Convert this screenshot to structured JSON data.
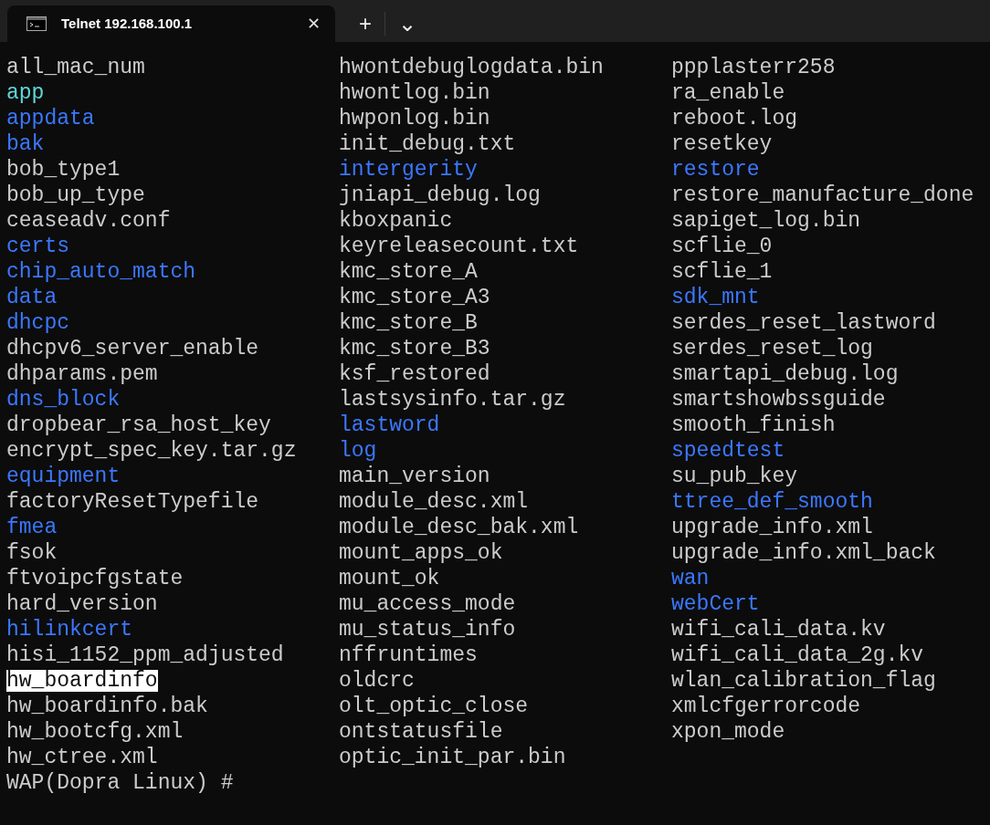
{
  "tab": {
    "title": "Telnet 192.168.100.1",
    "selected": true,
    "close": "✕"
  },
  "tab_actions": {
    "new_tab": "+",
    "dropdown": "⌄"
  },
  "entries": [
    {
      "name": "all_mac_num",
      "kind": "file",
      "selected": false
    },
    {
      "name": "app",
      "kind": "link",
      "selected": false
    },
    {
      "name": "appdata",
      "kind": "dir",
      "selected": false
    },
    {
      "name": "bak",
      "kind": "dir",
      "selected": false
    },
    {
      "name": "bob_type1",
      "kind": "file",
      "selected": false
    },
    {
      "name": "bob_up_type",
      "kind": "file",
      "selected": false
    },
    {
      "name": "ceaseadv.conf",
      "kind": "file",
      "selected": false
    },
    {
      "name": "certs",
      "kind": "dir",
      "selected": false
    },
    {
      "name": "chip_auto_match",
      "kind": "dir",
      "selected": false
    },
    {
      "name": "data",
      "kind": "dir",
      "selected": false
    },
    {
      "name": "dhcpc",
      "kind": "dir",
      "selected": false
    },
    {
      "name": "dhcpv6_server_enable",
      "kind": "file",
      "selected": false
    },
    {
      "name": "dhparams.pem",
      "kind": "file",
      "selected": false
    },
    {
      "name": "dns_block",
      "kind": "dir",
      "selected": false
    },
    {
      "name": "dropbear_rsa_host_key",
      "kind": "file",
      "selected": false
    },
    {
      "name": "encrypt_spec_key.tar.gz",
      "kind": "file",
      "selected": false
    },
    {
      "name": "equipment",
      "kind": "dir",
      "selected": false
    },
    {
      "name": "factoryResetTypefile",
      "kind": "file",
      "selected": false
    },
    {
      "name": "fmea",
      "kind": "dir",
      "selected": false
    },
    {
      "name": "fsok",
      "kind": "file",
      "selected": false
    },
    {
      "name": "ftvoipcfgstate",
      "kind": "file",
      "selected": false
    },
    {
      "name": "hard_version",
      "kind": "file",
      "selected": false
    },
    {
      "name": "hilinkcert",
      "kind": "dir",
      "selected": false
    },
    {
      "name": "hisi_1152_ppm_adjusted",
      "kind": "file",
      "selected": false
    },
    {
      "name": "hw_boardinfo",
      "kind": "file",
      "selected": true
    },
    {
      "name": "hw_boardinfo.bak",
      "kind": "file",
      "selected": false
    },
    {
      "name": "hw_bootcfg.xml",
      "kind": "file",
      "selected": false
    },
    {
      "name": "hw_ctree.xml",
      "kind": "file",
      "selected": false
    },
    {
      "name": "hwontdebuglogdata.bin",
      "kind": "file",
      "selected": false
    },
    {
      "name": "hwontlog.bin",
      "kind": "file",
      "selected": false
    },
    {
      "name": "hwponlog.bin",
      "kind": "file",
      "selected": false
    },
    {
      "name": "init_debug.txt",
      "kind": "file",
      "selected": false
    },
    {
      "name": "intergerity",
      "kind": "dir",
      "selected": false
    },
    {
      "name": "jniapi_debug.log",
      "kind": "file",
      "selected": false
    },
    {
      "name": "kboxpanic",
      "kind": "file",
      "selected": false
    },
    {
      "name": "keyreleasecount.txt",
      "kind": "file",
      "selected": false
    },
    {
      "name": "kmc_store_A",
      "kind": "file",
      "selected": false
    },
    {
      "name": "kmc_store_A3",
      "kind": "file",
      "selected": false
    },
    {
      "name": "kmc_store_B",
      "kind": "file",
      "selected": false
    },
    {
      "name": "kmc_store_B3",
      "kind": "file",
      "selected": false
    },
    {
      "name": "ksf_restored",
      "kind": "file",
      "selected": false
    },
    {
      "name": "lastsysinfo.tar.gz",
      "kind": "file",
      "selected": false
    },
    {
      "name": "lastword",
      "kind": "dir",
      "selected": false
    },
    {
      "name": "log",
      "kind": "dir",
      "selected": false
    },
    {
      "name": "main_version",
      "kind": "file",
      "selected": false
    },
    {
      "name": "module_desc.xml",
      "kind": "file",
      "selected": false
    },
    {
      "name": "module_desc_bak.xml",
      "kind": "file",
      "selected": false
    },
    {
      "name": "mount_apps_ok",
      "kind": "file",
      "selected": false
    },
    {
      "name": "mount_ok",
      "kind": "file",
      "selected": false
    },
    {
      "name": "mu_access_mode",
      "kind": "file",
      "selected": false
    },
    {
      "name": "mu_status_info",
      "kind": "file",
      "selected": false
    },
    {
      "name": "nffruntimes",
      "kind": "file",
      "selected": false
    },
    {
      "name": "oldcrc",
      "kind": "file",
      "selected": false
    },
    {
      "name": "olt_optic_close",
      "kind": "file",
      "selected": false
    },
    {
      "name": "ontstatusfile",
      "kind": "file",
      "selected": false
    },
    {
      "name": "optic_init_par.bin",
      "kind": "file",
      "selected": false
    },
    {
      "name": "ppplasterr258",
      "kind": "file",
      "selected": false
    },
    {
      "name": "ra_enable",
      "kind": "file",
      "selected": false
    },
    {
      "name": "reboot.log",
      "kind": "file",
      "selected": false
    },
    {
      "name": "resetkey",
      "kind": "file",
      "selected": false
    },
    {
      "name": "restore",
      "kind": "dir",
      "selected": false
    },
    {
      "name": "restore_manufacture_done",
      "kind": "file",
      "selected": false
    },
    {
      "name": "sapiget_log.bin",
      "kind": "file",
      "selected": false
    },
    {
      "name": "scflie_0",
      "kind": "file",
      "selected": false
    },
    {
      "name": "scflie_1",
      "kind": "file",
      "selected": false
    },
    {
      "name": "sdk_mnt",
      "kind": "dir",
      "selected": false
    },
    {
      "name": "serdes_reset_lastword",
      "kind": "file",
      "selected": false
    },
    {
      "name": "serdes_reset_log",
      "kind": "file",
      "selected": false
    },
    {
      "name": "smartapi_debug.log",
      "kind": "file",
      "selected": false
    },
    {
      "name": "smartshowbssguide",
      "kind": "file",
      "selected": false
    },
    {
      "name": "smooth_finish",
      "kind": "file",
      "selected": false
    },
    {
      "name": "speedtest",
      "kind": "dir",
      "selected": false
    },
    {
      "name": "su_pub_key",
      "kind": "file",
      "selected": false
    },
    {
      "name": "ttree_def_smooth",
      "kind": "dir",
      "selected": false
    },
    {
      "name": "upgrade_info.xml",
      "kind": "file",
      "selected": false
    },
    {
      "name": "upgrade_info.xml_back",
      "kind": "file",
      "selected": false
    },
    {
      "name": "wan",
      "kind": "dir",
      "selected": false
    },
    {
      "name": "webCert",
      "kind": "dir",
      "selected": false
    },
    {
      "name": "wifi_cali_data.kv",
      "kind": "file",
      "selected": false
    },
    {
      "name": "wifi_cali_data_2g.kv",
      "kind": "file",
      "selected": false
    },
    {
      "name": "wlan_calibration_flag",
      "kind": "file",
      "selected": false
    },
    {
      "name": "xmlcfgerrorcode",
      "kind": "file",
      "selected": false
    },
    {
      "name": "xpon_mode",
      "kind": "file",
      "selected": false
    }
  ],
  "prompt": "WAP(Dopra Linux) #"
}
